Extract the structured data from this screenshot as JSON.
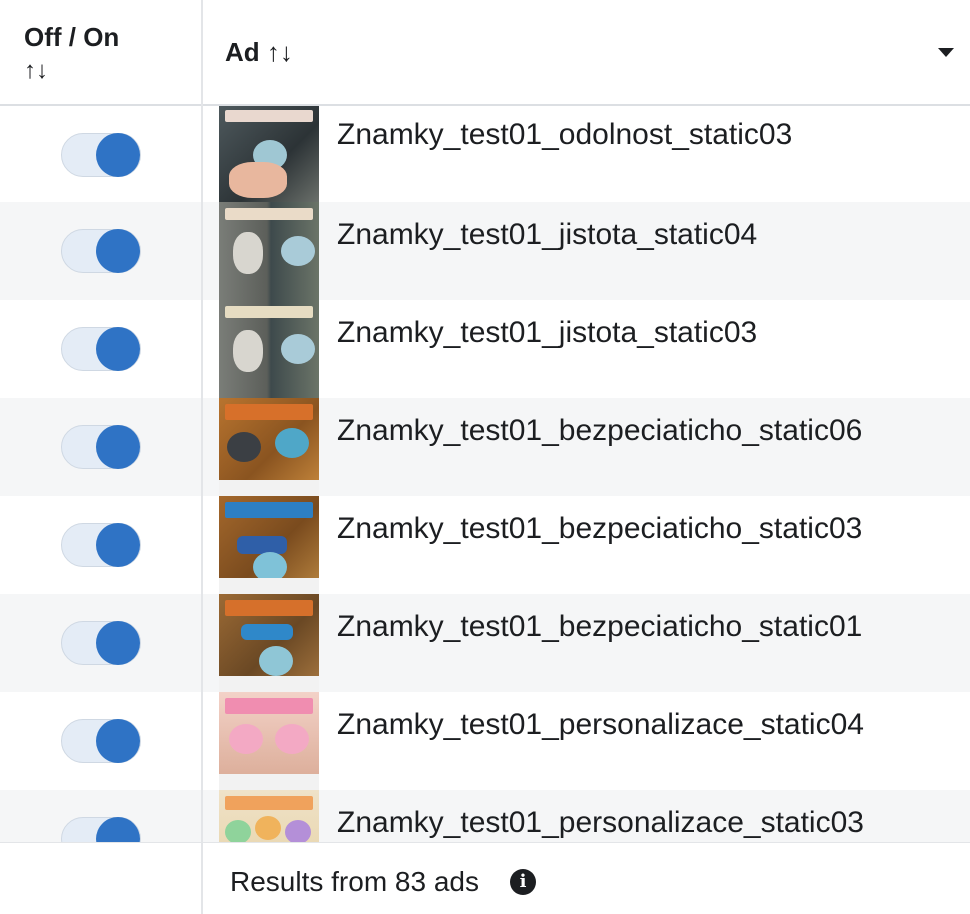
{
  "header": {
    "toggle_col_label": "Off / On",
    "toggle_col_sort": "↑↓",
    "ad_col_label": "Ad ↑↓"
  },
  "rows": [
    {
      "name": "Znamky_test01_odolnost_static03",
      "on": true
    },
    {
      "name": "Znamky_test01_jistota_static04",
      "on": true
    },
    {
      "name": "Znamky_test01_jistota_static03",
      "on": true
    },
    {
      "name": "Znamky_test01_bezpeciaticho_static06",
      "on": true
    },
    {
      "name": "Znamky_test01_bezpeciaticho_static03",
      "on": true
    },
    {
      "name": "Znamky_test01_bezpeciaticho_static01",
      "on": true
    },
    {
      "name": "Znamky_test01_personalizace_static04",
      "on": true
    },
    {
      "name": "Znamky_test01_personalizace_static03",
      "on": true
    }
  ],
  "footer": {
    "results_text": "Results from 83 ads",
    "info_icon": "info-icon"
  },
  "colors": {
    "toggle_knob": "#2f73c5",
    "toggle_track": "#e4ecf6",
    "alt_row": "#f5f6f7"
  }
}
